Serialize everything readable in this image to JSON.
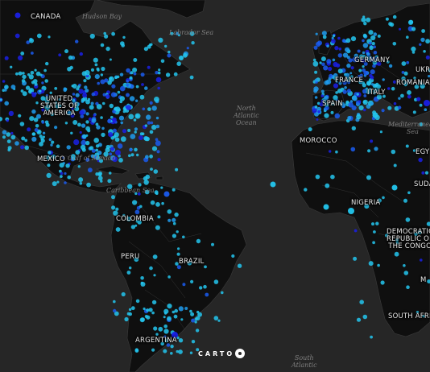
{
  "map": {
    "land_color": "#0f0f0f",
    "water_color": "#262626",
    "border_color": "#3a3a3a",
    "point_colors": [
      "#23c6ee",
      "#1f9cf0",
      "#1a5cf0",
      "#1a20e6"
    ],
    "country_labels": {
      "canada": "CANADA",
      "usa": "UNITED\nSTATES OF\nAMERICA",
      "mexico": "MEXICO",
      "colombia": "COLOMBIA",
      "peru": "PERU",
      "brazil": "BRAZIL",
      "argentina": "ARGENTINA",
      "morocco": "MOROCCO",
      "nigeria": "NIGERIA",
      "drc": "DEMOCRATIC\nREPUBLIC OF\nTHE CONGO",
      "south_africa": "SOUTH AFRIC",
      "spain": "SPAIN",
      "france": "FRANCE",
      "germany": "GERMANY",
      "italy": "ITALY",
      "romania": "ROMANIA",
      "ukraine": "UKR",
      "egypt": "EGY",
      "sudan": "SUDA",
      "malawi_partial": "M"
    },
    "water_labels": {
      "hudson_bay": "Hudson Bay",
      "labrador_sea": "Labrador Sea",
      "north_atlantic": "North\nAtlantic\nOcean",
      "gulf_of_mexico": "Gulf of Mexico",
      "caribbean_sea": "Caribbean Sea",
      "mediterranean": "Mediterranean\nSea",
      "south_atlantic": "South\nAtlantic"
    },
    "attribution": "CARTO"
  }
}
